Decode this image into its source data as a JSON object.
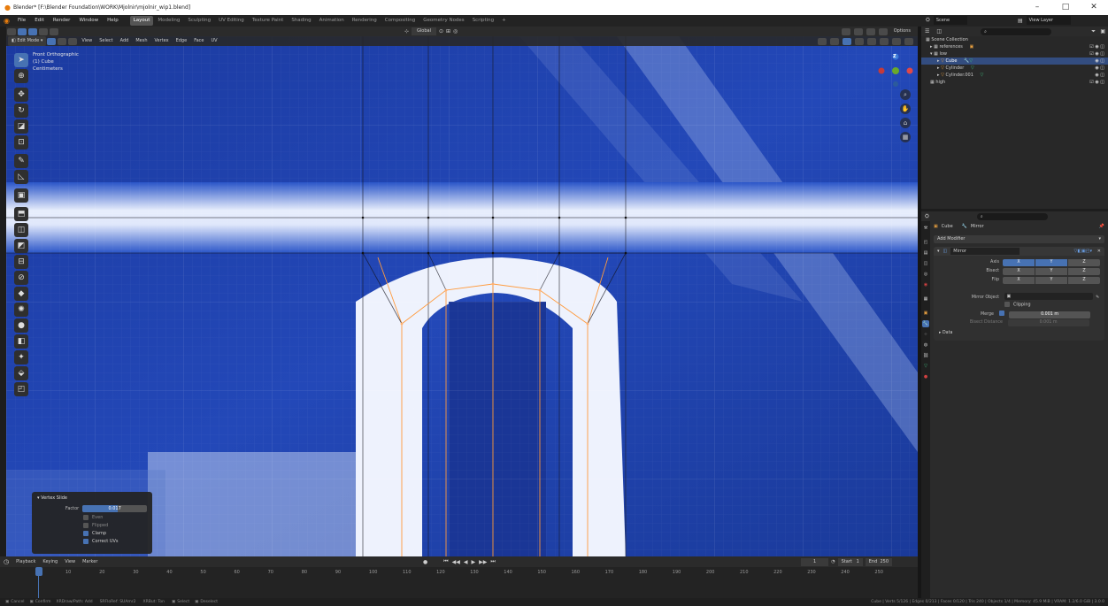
{
  "window": {
    "title": "Blender* [F:\\Blender Foundation\\WORK\\Mjolnir\\mjolnir_wip1.blend]",
    "controls": [
      "–",
      "□",
      "✕"
    ]
  },
  "menubar": {
    "menus": [
      "File",
      "Edit",
      "Render",
      "Window",
      "Help"
    ],
    "workspaces": [
      "Layout",
      "Modeling",
      "Sculpting",
      "UV Editing",
      "Texture Paint",
      "Shading",
      "Animation",
      "Rendering",
      "Compositing",
      "Geometry Nodes",
      "Scripting"
    ],
    "active_workspace": "Layout",
    "add_tab": "+",
    "scene": "Scene",
    "view_layer": "View Layer"
  },
  "viewport_header": {
    "mode": "Edit Mode",
    "menus": [
      "View",
      "Select",
      "Add",
      "Mesh",
      "Vertex",
      "Edge",
      "Face",
      "UV"
    ],
    "transform_orientation": "Global",
    "options": "Options"
  },
  "viewport_info": {
    "view": "Front Orthographic",
    "object": "(1) Cube",
    "units": "Centimeters"
  },
  "gizmo": {
    "axis_label": "Z"
  },
  "redo_panel": {
    "title": "Vertex Slide",
    "factor_label": "Factor",
    "factor_value": "0.017",
    "options": [
      {
        "label": "Even",
        "checked": false
      },
      {
        "label": "Flipped",
        "checked": false
      },
      {
        "label": "Clamp",
        "checked": true
      },
      {
        "label": "Correct UVs",
        "checked": true
      }
    ]
  },
  "timeline": {
    "menus": [
      "Playback",
      "Keying",
      "View",
      "Marker"
    ],
    "current_frame": "1",
    "start_label": "Start",
    "start": "1",
    "end_label": "End",
    "end": "250",
    "ticks": [
      "1",
      "10",
      "20",
      "30",
      "40",
      "50",
      "60",
      "70",
      "80",
      "90",
      "100",
      "110",
      "120",
      "130",
      "140",
      "150",
      "160",
      "170",
      "180",
      "190",
      "200",
      "210",
      "220",
      "230",
      "240",
      "250"
    ]
  },
  "statusbar": {
    "left": [
      "Cancel",
      "Confirm",
      "XRDraw/Path: Add",
      "SRFloRef: SUAmr2",
      "XRBut: Ton",
      "Select",
      "Deselect"
    ],
    "right": "Cube | Verts 5/126 | Edges 0/213 | Faces 0/120 | Tris 240 | Objects 1/4 | Memory: 45.9 MiB | VRAM: 1.2/6.0 GiB | 3.0.0"
  },
  "outliner": {
    "root": "Scene Collection",
    "items": [
      {
        "label": "references",
        "indent": 1,
        "selected": false
      },
      {
        "label": "low",
        "indent": 1,
        "selected": false
      },
      {
        "label": "Cube",
        "indent": 2,
        "selected": true
      },
      {
        "label": "Cylinder",
        "indent": 2,
        "selected": false
      },
      {
        "label": "Cylinder.001",
        "indent": 2,
        "selected": false
      },
      {
        "label": "high",
        "indent": 1,
        "selected": false
      }
    ]
  },
  "properties": {
    "object": "Cube",
    "modifier_tab": "Mirror",
    "add_modifier": "Add Modifier",
    "modifier_name": "Mirror",
    "rows": [
      {
        "label": "Axis",
        "values": [
          "X",
          "Y",
          "Z"
        ],
        "active": [
          true,
          true,
          false
        ]
      },
      {
        "label": "Bisect",
        "values": [
          "X",
          "Y",
          "Z"
        ],
        "active": [
          false,
          false,
          false
        ]
      },
      {
        "label": "Flip",
        "values": [
          "X",
          "Y",
          "Z"
        ],
        "active": [
          false,
          false,
          false
        ]
      }
    ],
    "mirror_object_label": "Mirror Object",
    "clipping_label": "Clipping",
    "merge_label": "Merge",
    "merge_value": "0.001 m",
    "bisect_distance_label": "Bisect Distance",
    "bisect_distance_value": "0.001 m",
    "data_label": "Data"
  },
  "colors": {
    "accent": "#4772b3",
    "mesh_edge": "#ff9a3c",
    "viewport_bg": "#1f3d9e"
  }
}
